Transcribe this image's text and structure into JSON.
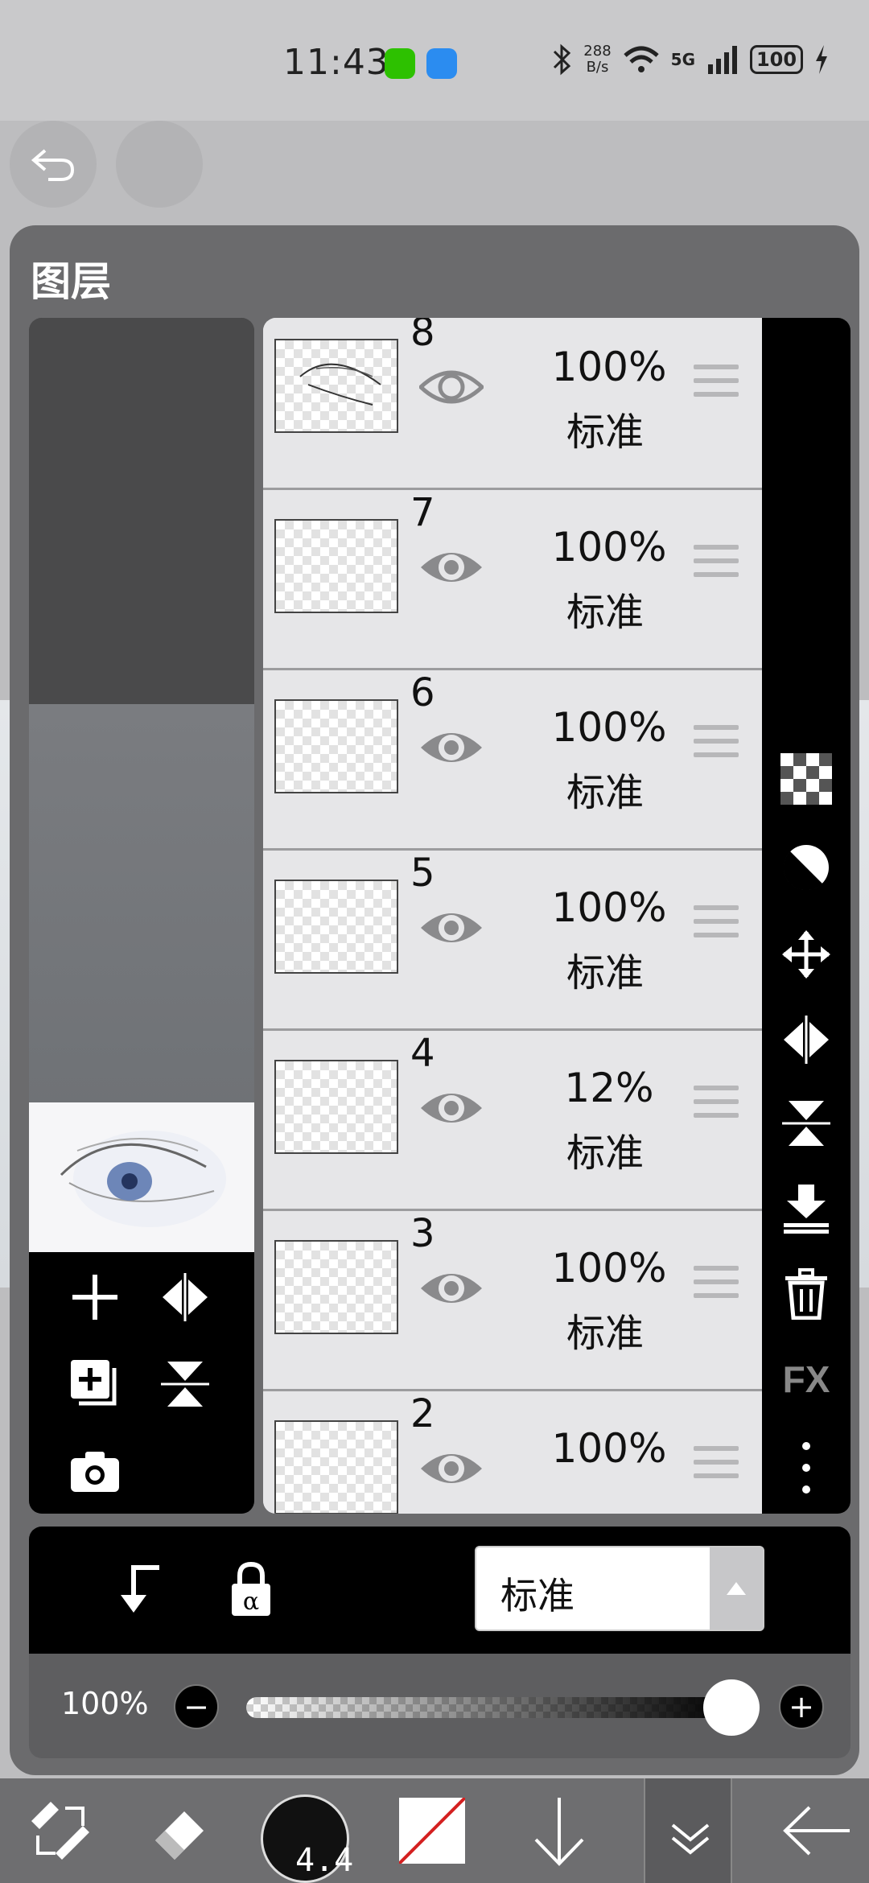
{
  "status_bar": {
    "time": "11:43",
    "net_speed_value": "288",
    "net_speed_unit": "B/s",
    "network": "5G",
    "battery": "100"
  },
  "panel": {
    "title": "图层"
  },
  "layers": [
    {
      "number": "8",
      "opacity": "100%",
      "mode": "标准",
      "visible_icon": "eye-outline-icon"
    },
    {
      "number": "7",
      "opacity": "100%",
      "mode": "标准",
      "visible_icon": "eye-icon"
    },
    {
      "number": "6",
      "opacity": "100%",
      "mode": "标准",
      "visible_icon": "eye-icon"
    },
    {
      "number": "5",
      "opacity": "100%",
      "mode": "标准",
      "visible_icon": "eye-icon"
    },
    {
      "number": "4",
      "opacity": "12%",
      "mode": "标准",
      "visible_icon": "eye-icon"
    },
    {
      "number": "3",
      "opacity": "100%",
      "mode": "标准",
      "visible_icon": "eye-icon"
    },
    {
      "number": "2",
      "opacity": "100%",
      "mode": "",
      "visible_icon": "eye-icon"
    }
  ],
  "right_tools": [
    "checkerboard-icon",
    "invert-circle-icon",
    "move-icon",
    "flip-horizontal-icon",
    "flip-vertical-icon",
    "merge-down-icon",
    "trash-icon",
    "fx-icon",
    "more-vert-icon"
  ],
  "fx_label": "FX",
  "left_tools": [
    "add-layer-icon",
    "flip-horizontal-icon",
    "duplicate-layer-icon",
    "flip-vertical-icon",
    "camera-icon"
  ],
  "bottom_bar": {
    "blend_mode": "标准"
  },
  "opacity_row": {
    "value": "100%",
    "minus": "−",
    "plus": "+",
    "slider_level": 1.0
  },
  "toolbar": {
    "brush_size": "4.4",
    "items": [
      "transform-icon",
      "eraser-icon",
      "brush-size",
      "color-swatch",
      "arrow-down-icon",
      "layers-toggle-icon",
      "back-arrow-icon"
    ]
  }
}
